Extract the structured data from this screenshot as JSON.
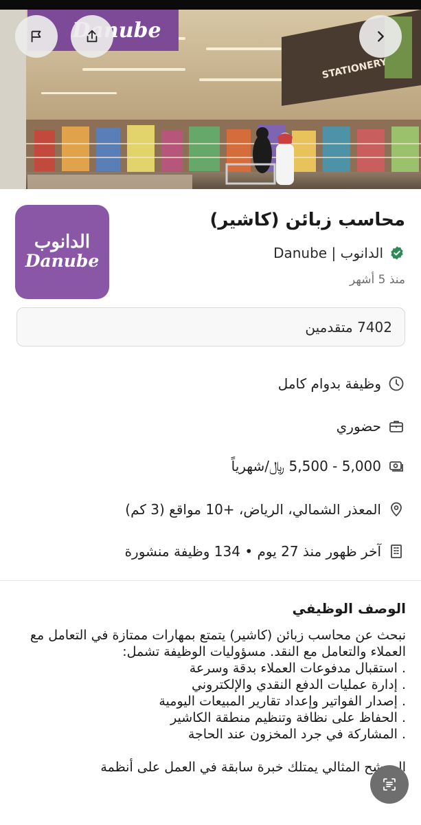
{
  "hero": {
    "storefront_text": "Danube",
    "side_sign_text": "STATIONERY"
  },
  "buttons": {
    "report_icon": "flag-icon",
    "share_icon": "share-icon",
    "next_icon": "chevron-right-icon"
  },
  "company": {
    "logo_ar": "الدانوب",
    "logo_en": "Danube",
    "name": "Danube | الدانوب",
    "verified_icon": "verified-check-icon",
    "verified_color": "#2e8b57",
    "brand_color": "#8a57a7"
  },
  "job": {
    "title": "محاسب زبائن (كاشير)",
    "posted": "منذ 5 أشهر",
    "applicants": "7402 متقدمين"
  },
  "details": [
    {
      "icon": "clock-icon",
      "text": "وظيفة بدوام كامل"
    },
    {
      "icon": "briefcase-icon",
      "text": "حضوري"
    },
    {
      "icon": "money-icon",
      "text": "5,000 - 5,500 ﷼/شهرياً"
    },
    {
      "icon": "location-pin-icon",
      "text": "المعذر الشمالي، الرياض، +10 مواقع (3 كم)"
    },
    {
      "icon": "building-icon",
      "text": "آخر ظهور منذ 27 يوم • 134 وظيفة منشورة"
    }
  ],
  "description": {
    "heading": "الوصف الوظيفي",
    "intro": "نبحث عن محاسب زبائن (كاشير) يتمتع بمهارات ممتازة في التعامل مع العملاء والتعامل مع النقد. مسؤوليات الوظيفة تشمل:",
    "items": [
      "استقبال مدفوعات العملاء بدقة وسرعة",
      "إدارة عمليات الدفع النقدي والإلكتروني",
      "إصدار الفواتير وإعداد تقارير المبيعات اليومية",
      "الحفاظ على نظافة وتنظيم منطقة الكاشير",
      "المشاركة في جرد المخزون عند الحاجة"
    ],
    "ideal": "المرشح المثالي يمتلك خبرة سابقة في العمل على أنظمة"
  },
  "fab": {
    "icon": "summary-icon"
  }
}
